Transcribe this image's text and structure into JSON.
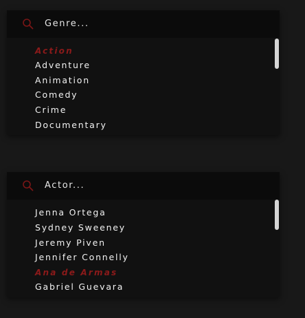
{
  "genre_panel": {
    "search_placeholder": "Genre...",
    "items": [
      {
        "label": "Action",
        "selected": true
      },
      {
        "label": "Adventure",
        "selected": false
      },
      {
        "label": "Animation",
        "selected": false
      },
      {
        "label": "Comedy",
        "selected": false
      },
      {
        "label": "Crime",
        "selected": false
      },
      {
        "label": "Documentary",
        "selected": false
      }
    ]
  },
  "actor_panel": {
    "search_placeholder": "Actor...",
    "items": [
      {
        "label": "Jenna Ortega",
        "selected": false
      },
      {
        "label": "Sydney Sweeney",
        "selected": false
      },
      {
        "label": "Jeremy Piven",
        "selected": false
      },
      {
        "label": "Jennifer Connelly",
        "selected": false
      },
      {
        "label": "Ana de Armas",
        "selected": true
      },
      {
        "label": "Gabriel Guevara",
        "selected": false
      }
    ]
  },
  "colors": {
    "background": "#181818",
    "panel": "#111111",
    "search_bar": "#0b0b0b",
    "text": "#f2f2f2",
    "selected_text": "#8b1a1a",
    "search_icon": "#7a1616",
    "scrollbar": "#d6d6d6"
  },
  "icons": {
    "search": "search-icon"
  }
}
